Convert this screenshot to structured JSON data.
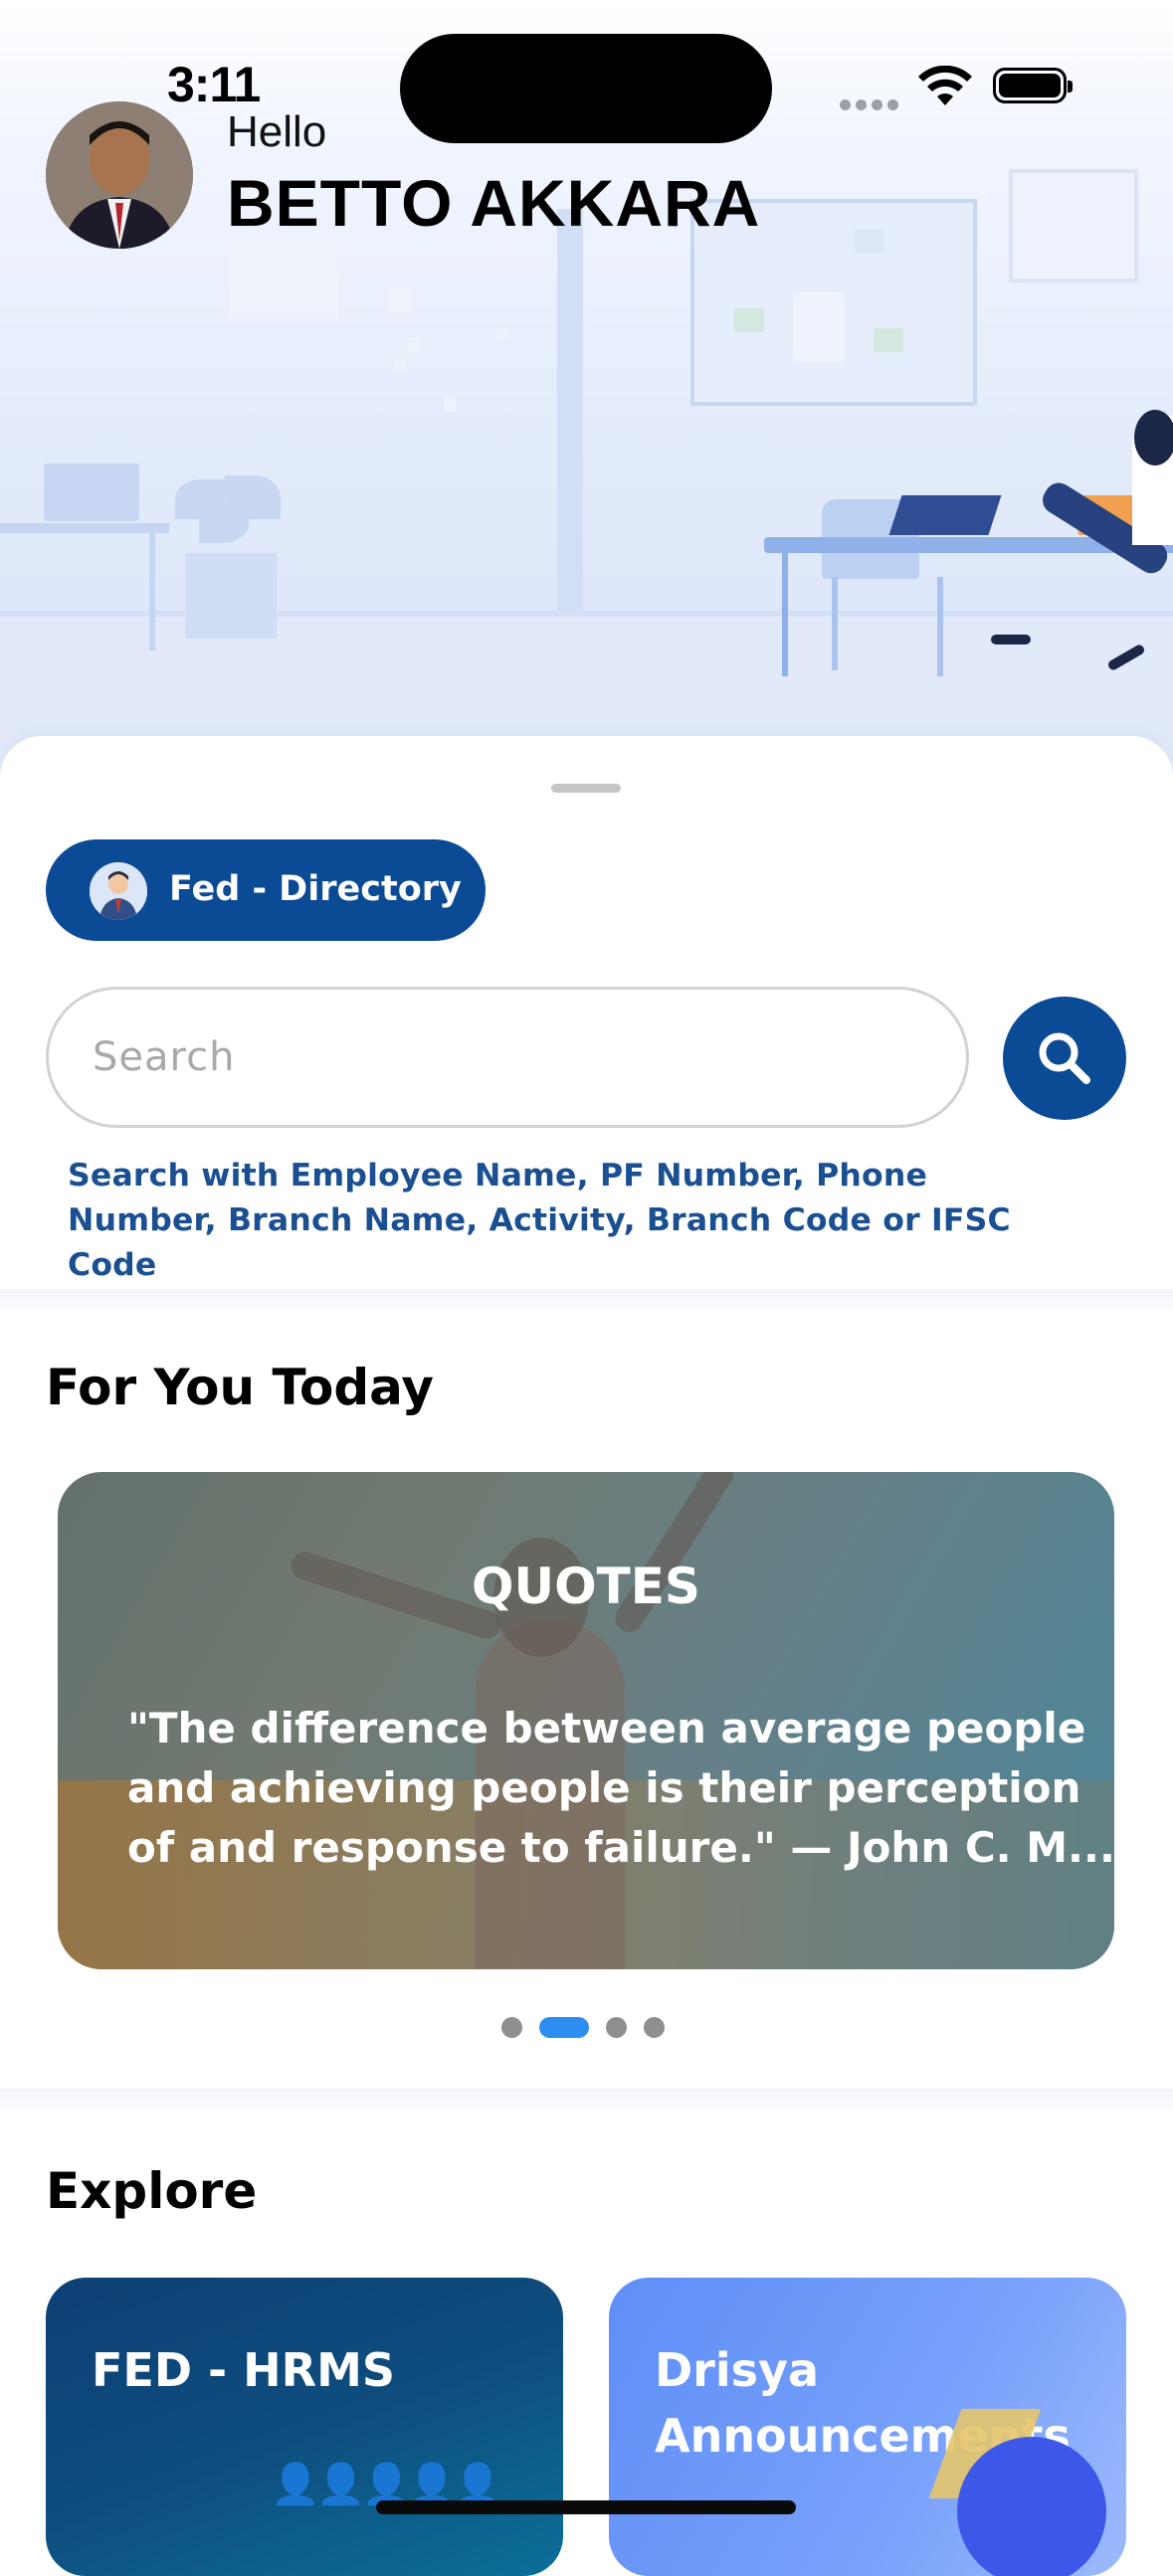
{
  "status_bar": {
    "time": "3:11"
  },
  "header": {
    "greeting": "Hello",
    "user_name": "BETTO AKKARA"
  },
  "directory": {
    "chip_label": "Fed - Directory",
    "search_placeholder": "Search",
    "search_hint": "Search with Employee Name, PF Number, Phone Number, Branch Name, Activity, Branch Code or IFSC Code"
  },
  "for_you": {
    "title": "For You Today",
    "card": {
      "heading": "QUOTES",
      "quote_line1": "\"The difference between average people",
      "quote_line2": "and achieving people is their perception",
      "quote_line3": "of and response to failure.\" — John C. M..."
    },
    "carousel": {
      "total": 4,
      "active_index": 1
    }
  },
  "explore": {
    "title": "Explore",
    "cards": [
      {
        "label": "FED - HRMS"
      },
      {
        "label_line1": "Drisya",
        "label_line2": "Announcements"
      }
    ]
  },
  "colors": {
    "primary": "#0b4a95",
    "hint_text": "#1a4f91",
    "active_dot": "#2b8ef0",
    "inactive_dot": "#8f8f8f"
  }
}
